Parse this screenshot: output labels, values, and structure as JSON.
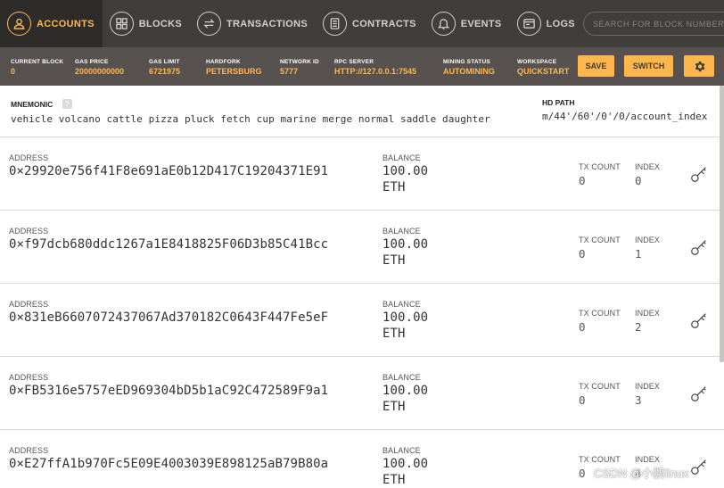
{
  "nav": {
    "items": [
      {
        "label": "ACCOUNTS",
        "icon": "account-icon",
        "active": true
      },
      {
        "label": "BLOCKS",
        "icon": "blocks-icon",
        "active": false
      },
      {
        "label": "TRANSACTIONS",
        "icon": "transactions-icon",
        "active": false
      },
      {
        "label": "CONTRACTS",
        "icon": "contracts-icon",
        "active": false
      },
      {
        "label": "EVENTS",
        "icon": "events-icon",
        "active": false
      },
      {
        "label": "LOGS",
        "icon": "logs-icon",
        "active": false
      }
    ],
    "search_placeholder": "SEARCH FOR BLOCK NUMBERS OR TX HASHES"
  },
  "status": {
    "current_block": {
      "label": "CURRENT BLOCK",
      "value": "0"
    },
    "gas_price": {
      "label": "GAS PRICE",
      "value": "20000000000"
    },
    "gas_limit": {
      "label": "GAS LIMIT",
      "value": "6721975"
    },
    "hardfork": {
      "label": "HARDFORK",
      "value": "PETERSBURG"
    },
    "network_id": {
      "label": "NETWORK ID",
      "value": "5777"
    },
    "rpc_server": {
      "label": "RPC SERVER",
      "value": "HTTP://127.0.0.1:7545"
    },
    "mining_status": {
      "label": "MINING STATUS",
      "value": "AUTOMINING"
    },
    "workspace": {
      "label": "WORKSPACE",
      "value": "QUICKSTART"
    },
    "save_label": "SAVE",
    "switch_label": "SWITCH"
  },
  "mnemonic": {
    "title": "MNEMONIC",
    "help": "?",
    "words": "vehicle volcano cattle pizza pluck fetch cup marine merge normal saddle daughter",
    "hd_path_title": "HD PATH",
    "hd_path": "m/44'/60'/0'/0/account_index"
  },
  "labels": {
    "address": "ADDRESS",
    "balance": "BALANCE",
    "tx_count": "TX COUNT",
    "index": "INDEX"
  },
  "accounts": [
    {
      "address": "0×29920e756f41F8e691aE0b12D417C19204371E91",
      "balance": "100.00",
      "unit": "ETH",
      "tx_count": "0",
      "index": "0"
    },
    {
      "address": "0×f97dcb680ddc1267a1E8418825F06D3b85C41Bcc",
      "balance": "100.00",
      "unit": "ETH",
      "tx_count": "0",
      "index": "1"
    },
    {
      "address": "0×831eB6607072437067Ad370182C0643F447Fe5eF",
      "balance": "100.00",
      "unit": "ETH",
      "tx_count": "0",
      "index": "2"
    },
    {
      "address": "0×FB5316e5757eED969304bD5b1aC92C472589F9a1",
      "balance": "100.00",
      "unit": "ETH",
      "tx_count": "0",
      "index": "3"
    },
    {
      "address": "0×E27ffA1b970Fc5E09E4003039E898125aB79B80a",
      "balance": "100.00",
      "unit": "ETH",
      "tx_count": "0",
      "index": "4"
    }
  ],
  "watermark": "CSDN @小鹏linux",
  "colors": {
    "accent": "#ffb74d",
    "nav_bg": "#3f3e3c",
    "status_bg": "#57524f"
  }
}
